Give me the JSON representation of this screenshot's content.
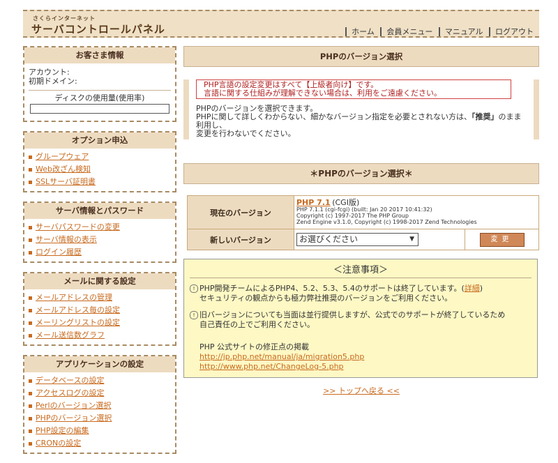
{
  "header": {
    "logo_small": "さくらインターネット",
    "logo_big": "サーバコントロールパネル",
    "nav": [
      "ホーム",
      "会員メニュー",
      "マニュアル",
      "ログアウト"
    ]
  },
  "sidebar": {
    "account": {
      "title": "お客さま情報",
      "account_label": "アカウント:",
      "domain_label": "初期ドメイン:",
      "disk_label": "ディスクの使用量(使用率)"
    },
    "options": {
      "title": "オプション申込",
      "items": [
        "グループウェア",
        "Web改ざん検知",
        "SSLサーバ証明書"
      ]
    },
    "server": {
      "title": "サーバ情報とパスワード",
      "items": [
        "サーバパスワードの変更",
        "サーバ情報の表示",
        "ログイン履歴"
      ]
    },
    "mail": {
      "title": "メールに関する設定",
      "items": [
        "メールアドレスの管理",
        "メールアドレス毎の設定",
        "メーリングリストの設定",
        "メール送信数グラフ"
      ]
    },
    "apps": {
      "title": "アプリケーションの設定",
      "items": [
        "データベースの設定",
        "アクセスログの設定",
        "Perlのバージョン選択",
        "PHPのバージョン選択",
        "PHP設定の編集",
        "CRONの設定"
      ]
    }
  },
  "main": {
    "page_title": "PHPのバージョン選択",
    "warning_line1": "PHP言語の設定変更はすべて【上級者向け】です。",
    "warning_line2": "言語に関する仕組みが理解できない場合は、利用をご遠慮ください。",
    "desc_line1": "PHPのバージョンを選択できます。",
    "desc_line2_pre": "PHPに関して詳しくわからない、細かなバージョン指定を必要とされない方は、",
    "desc_line2_bold": "「推奨」",
    "desc_line2_post": "のまま利用し、",
    "desc_line3": "変更を行わないでください。",
    "section_title": "＊PHPのバージョン選択＊",
    "current_label": "現在のバージョン",
    "current_version": "PHP 7.1",
    "current_note": "(CGI版)",
    "current_detail1": "PHP 7.1.1 (cgi-fcgi) (built: Jan 20 2017 10:41:32)",
    "current_detail2": "Copyright (c) 1997-2017 The PHP Group",
    "current_detail3": "Zend Engine v3.1.0, Copyright (c) 1998-2017 Zend Technologies",
    "new_label": "新しいバージョン",
    "select_value": "お選びください",
    "change_button": "変更",
    "caution_title": "＜注意事項＞",
    "caution1_pre": "PHP開発チームによるPHP4、5.2、5.3、5.4のサポートは終了しています。(",
    "caution1_link": "詳細",
    "caution1_post": ")",
    "caution1_line2": "セキュリティの観点からも極力弊社推奨のバージョンをご利用ください。",
    "caution2_line1": "旧バージョンについても当面は並行提供しますが、公式でのサポートが終了しているため",
    "caution2_line2": "自己責任の上でご利用ください。",
    "php_site_label": "PHP 公式サイトの修正点の掲載",
    "link1": "http://jp.php.net/manual/ja/migration5.php",
    "link2": "http://www.php.net/ChangeLog-5.php",
    "back_to_top": ">> トップへ戻る <<"
  },
  "colors": {
    "accent": "#c86a1e",
    "panel": "#eddbc0",
    "warning": "#d04040",
    "caution_bg": "#fdf8c4"
  }
}
